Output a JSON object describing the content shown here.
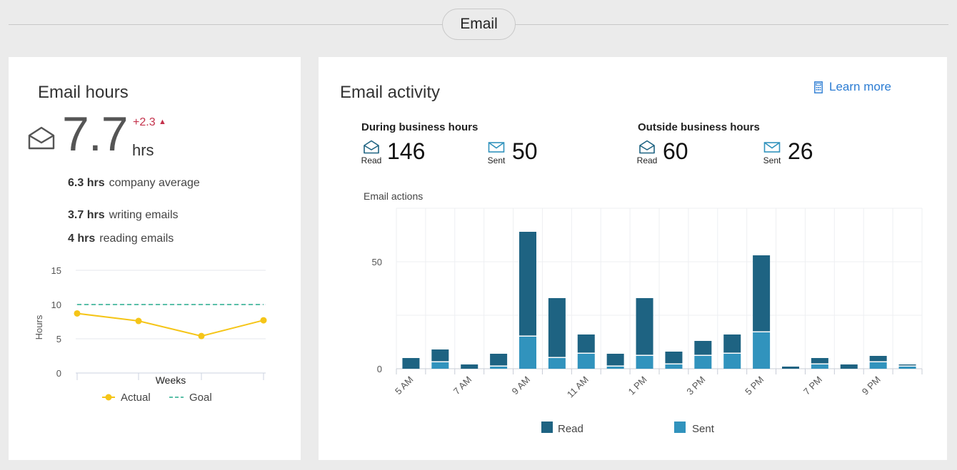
{
  "section": {
    "title": "Email"
  },
  "hours": {
    "title": "Email hours",
    "value": "7.7",
    "unit": "hrs",
    "delta": "+2.3",
    "delta_icon": "triangle-up",
    "company_avg": {
      "value": "6.3 hrs",
      "label": "company average"
    },
    "writing": {
      "value": "3.7 hrs",
      "label": "writing emails"
    },
    "reading": {
      "value": "4 hrs",
      "label": "reading emails"
    }
  },
  "activity": {
    "title": "Email activity",
    "learn_more": "Learn more",
    "during": {
      "heading": "During business hours",
      "read_label": "Read",
      "read_value": "146",
      "sent_label": "Sent",
      "sent_value": "50"
    },
    "outside": {
      "heading": "Outside business hours",
      "read_label": "Read",
      "read_value": "60",
      "sent_label": "Sent",
      "sent_value": "26"
    }
  },
  "colors": {
    "read": "#1e6382",
    "sent": "#3193bd",
    "actual": "#f5c518",
    "goal": "#5bc0a8",
    "delta": "#c4314b",
    "link": "#2b7cd3"
  },
  "chart_data": [
    {
      "type": "line",
      "xlabel": "Weeks",
      "ylabel": "Hours",
      "ylim": [
        0,
        15
      ],
      "yticks": [
        0,
        5,
        10,
        15
      ],
      "x": [
        1,
        2,
        3,
        4
      ],
      "series": [
        {
          "name": "Actual",
          "values": [
            8.7,
            7.6,
            5.4,
            7.7
          ]
        },
        {
          "name": "Goal",
          "values": [
            10,
            10,
            10,
            10
          ]
        }
      ],
      "legend": "bottom",
      "grid": true
    },
    {
      "type": "bar",
      "stacked": true,
      "title": "Email actions",
      "categories": [
        "5 AM",
        "6 AM",
        "7 AM",
        "8 AM",
        "9 AM",
        "10 AM",
        "11 AM",
        "12 PM",
        "1 PM",
        "2 PM",
        "3 PM",
        "4 PM",
        "5 PM",
        "6 PM",
        "7 PM",
        "8 PM",
        "9 PM",
        "10 PM"
      ],
      "tick_labels": [
        "5 AM",
        "",
        "7 AM",
        "",
        "9 AM",
        "",
        "11 AM",
        "",
        "1 PM",
        "",
        "3 PM",
        "",
        "5 PM",
        "",
        "7 PM",
        "",
        "9 PM",
        ""
      ],
      "series": [
        {
          "name": "Sent",
          "values": [
            0,
            3,
            0,
            1,
            15,
            5,
            7,
            1,
            6,
            2,
            6,
            7,
            17,
            0,
            2,
            0,
            3,
            1
          ]
        },
        {
          "name": "Read",
          "values": [
            5,
            6,
            2,
            6,
            49,
            28,
            9,
            6,
            27,
            6,
            7,
            9,
            36,
            1,
            3,
            2,
            3,
            1
          ]
        }
      ],
      "ylim": [
        0,
        75
      ],
      "yticks": [
        0,
        50
      ],
      "legend": "bottom",
      "grid": true
    }
  ]
}
